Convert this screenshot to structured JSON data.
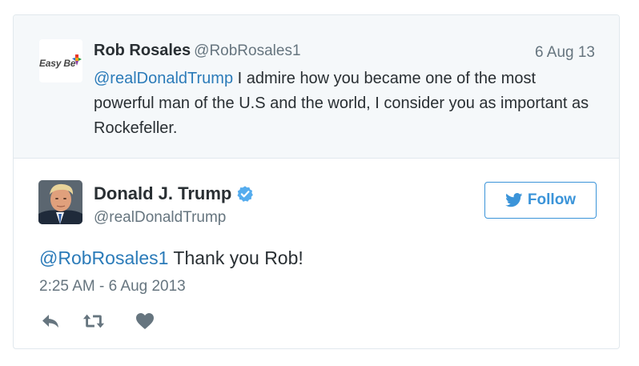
{
  "parent_tweet": {
    "author_name": "Rob Rosales",
    "author_handle": "@RobRosales1",
    "date": "6 Aug 13",
    "mention": "@realDonaldTrump",
    "text": " I admire how you became one of the most powerful man of the U.S and the world, I consider you as important as Rockefeller.",
    "avatar_logo_text": "Easy Be"
  },
  "main_tweet": {
    "author_name": "Donald J. Trump",
    "author_handle": "@realDonaldTrump",
    "verified_icon": "verified-badge-icon",
    "follow_label": "Follow",
    "mention": "@RobRosales1",
    "text": " Thank you Rob!",
    "timestamp": "2:25 AM - 6 Aug 2013"
  },
  "actions": [
    "reply-icon",
    "retweet-icon",
    "like-icon"
  ],
  "colors": {
    "link": "#2b7bb9",
    "follow": "#3b94d9",
    "muted": "#66757f",
    "text": "#292f33",
    "parent_bg": "#f5f8fa",
    "border": "#e1e8ed"
  }
}
